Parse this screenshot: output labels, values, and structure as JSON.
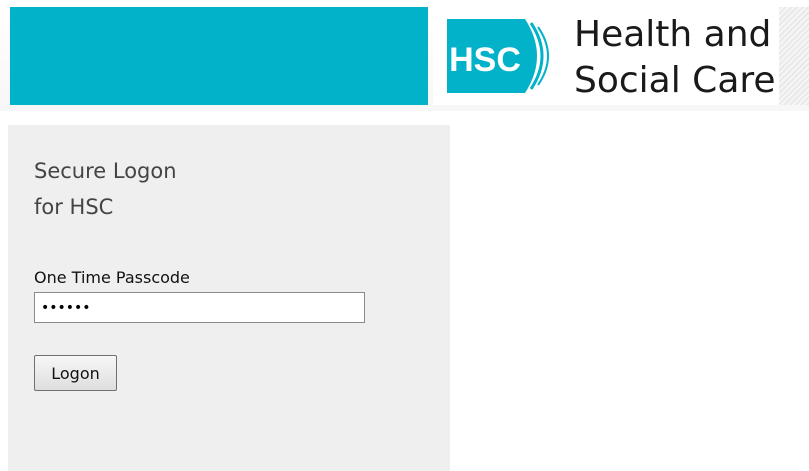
{
  "header": {
    "brand_line1": "Health and",
    "brand_line2": "Social Care",
    "badge_text": "HSC",
    "accent_color": "#02b2c9"
  },
  "form": {
    "title_line1": "Secure Logon",
    "title_line2": "for HSC",
    "passcode_label": "One Time Passcode",
    "passcode_value": "••••••",
    "logon_button": "Logon"
  }
}
